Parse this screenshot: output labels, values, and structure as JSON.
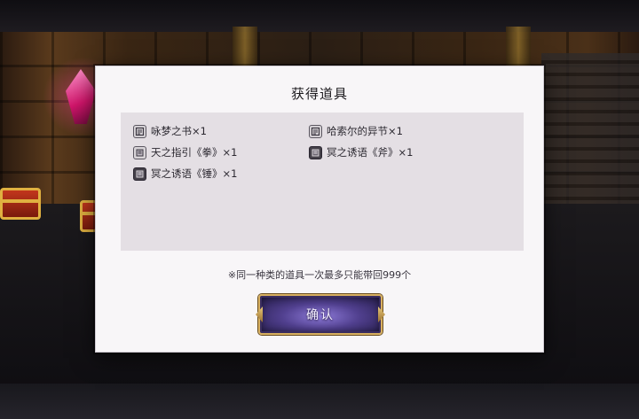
{
  "dialog": {
    "title": "获得道具",
    "items": [
      {
        "label": "咏梦之书×1",
        "icon": "book-icon",
        "style": "light"
      },
      {
        "label": "哈索尔的异节×1",
        "icon": "book-icon",
        "style": "light"
      },
      {
        "label": "天之指引《拳》×1",
        "icon": "scroll-icon",
        "style": "light"
      },
      {
        "label": "冥之诱语《斧》×1",
        "icon": "scroll-icon",
        "style": "dark"
      },
      {
        "label": "冥之诱语《锤》×1",
        "icon": "scroll-icon",
        "style": "dark"
      }
    ],
    "notice": "※同一种类的道具一次最多只能带回999个",
    "confirm_label": "确认"
  },
  "colors": {
    "accent_gold": "#d8b060",
    "button_purple": "#51408f",
    "crystal_pink": "#ff3b9a"
  }
}
